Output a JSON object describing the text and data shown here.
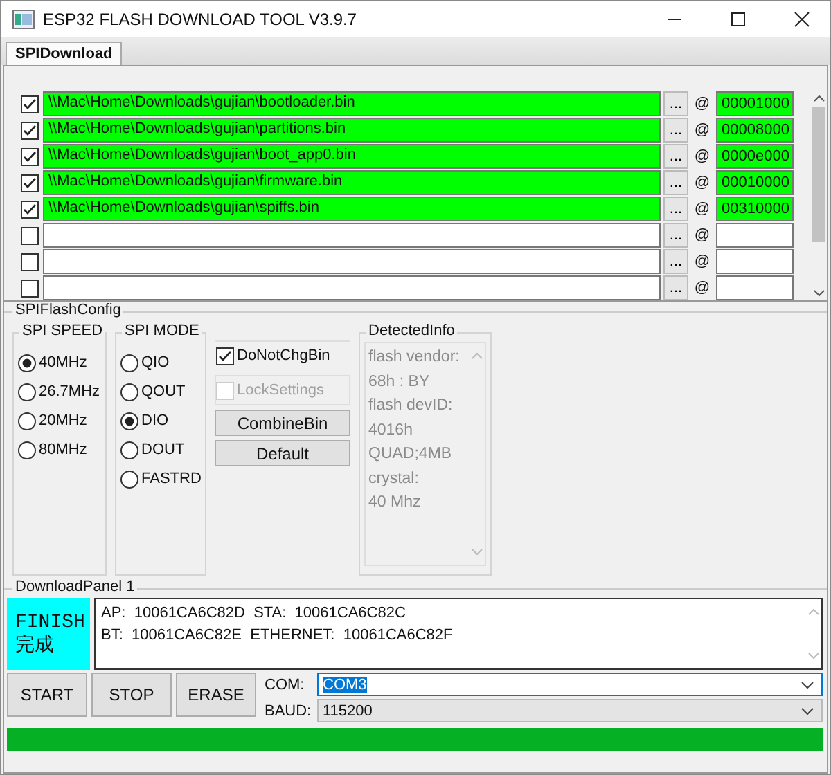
{
  "window": {
    "title": "ESP32 FLASH DOWNLOAD TOOL V3.9.7"
  },
  "tabs": [
    {
      "label": "SPIDownload",
      "selected": true
    }
  ],
  "files": [
    {
      "checked": true,
      "loaded": true,
      "path": "\\\\Mac\\Home\\Downloads\\gujian\\bootloader.bin",
      "browse": "...",
      "at": "@",
      "address": "00001000"
    },
    {
      "checked": true,
      "loaded": true,
      "path": "\\\\Mac\\Home\\Downloads\\gujian\\partitions.bin",
      "browse": "...",
      "at": "@",
      "address": "00008000"
    },
    {
      "checked": true,
      "loaded": true,
      "path": "\\\\Mac\\Home\\Downloads\\gujian\\boot_app0.bin",
      "browse": "...",
      "at": "@",
      "address": "0000e000"
    },
    {
      "checked": true,
      "loaded": true,
      "path": "\\\\Mac\\Home\\Downloads\\gujian\\firmware.bin",
      "browse": "...",
      "at": "@",
      "address": "00010000"
    },
    {
      "checked": true,
      "loaded": true,
      "path": "\\\\Mac\\Home\\Downloads\\gujian\\spiffs.bin",
      "browse": "...",
      "at": "@",
      "address": "00310000"
    },
    {
      "checked": false,
      "loaded": false,
      "browse": "...",
      "at": "@"
    },
    {
      "checked": false,
      "loaded": false,
      "browse": "...",
      "at": "@"
    },
    {
      "checked": false,
      "loaded": false,
      "browse": "...",
      "at": "@"
    }
  ],
  "spi_flash_config": {
    "title": "SPIFlashConfig",
    "spi_speed": {
      "title": "SPI SPEED",
      "options": [
        {
          "label": "40MHz",
          "selected": true
        },
        {
          "label": "26.7MHz",
          "selected": false
        },
        {
          "label": "20MHz",
          "selected": false
        },
        {
          "label": "80MHz",
          "selected": false
        }
      ]
    },
    "spi_mode": {
      "title": "SPI MODE",
      "options": [
        {
          "label": "QIO",
          "selected": false
        },
        {
          "label": "QOUT",
          "selected": false
        },
        {
          "label": "DIO",
          "selected": true
        },
        {
          "label": "DOUT",
          "selected": false
        },
        {
          "label": "FASTRD",
          "selected": false
        }
      ]
    },
    "do_not_chg_bin": {
      "label": "DoNotChgBin",
      "checked": true,
      "disabled": false
    },
    "lock_settings": {
      "label": "LockSettings",
      "checked": false,
      "disabled": true
    },
    "buttons": [
      "CombineBin",
      "Default"
    ],
    "detected_info": {
      "title": "DetectedInfo",
      "lines": [
        "flash vendor:",
        "68h : BY",
        "flash devID:",
        "4016h",
        "QUAD;4MB",
        "crystal:",
        "40 Mhz"
      ]
    }
  },
  "download_panel": {
    "title": "DownloadPanel 1",
    "status": [
      "FINISH",
      "完成"
    ],
    "log": [
      "AP:  10061CA6C82D  STA:  10061CA6C82C",
      "BT:  10061CA6C82E  ETHERNET:  10061CA6C82F"
    ],
    "buttons": [
      "START",
      "STOP",
      "ERASE"
    ],
    "com": {
      "label": "COM:",
      "value": "COM3",
      "focused": true
    },
    "baud": {
      "label": "BAUD:",
      "value": "115200",
      "focused": false
    },
    "progress": {
      "level": 1
    }
  }
}
